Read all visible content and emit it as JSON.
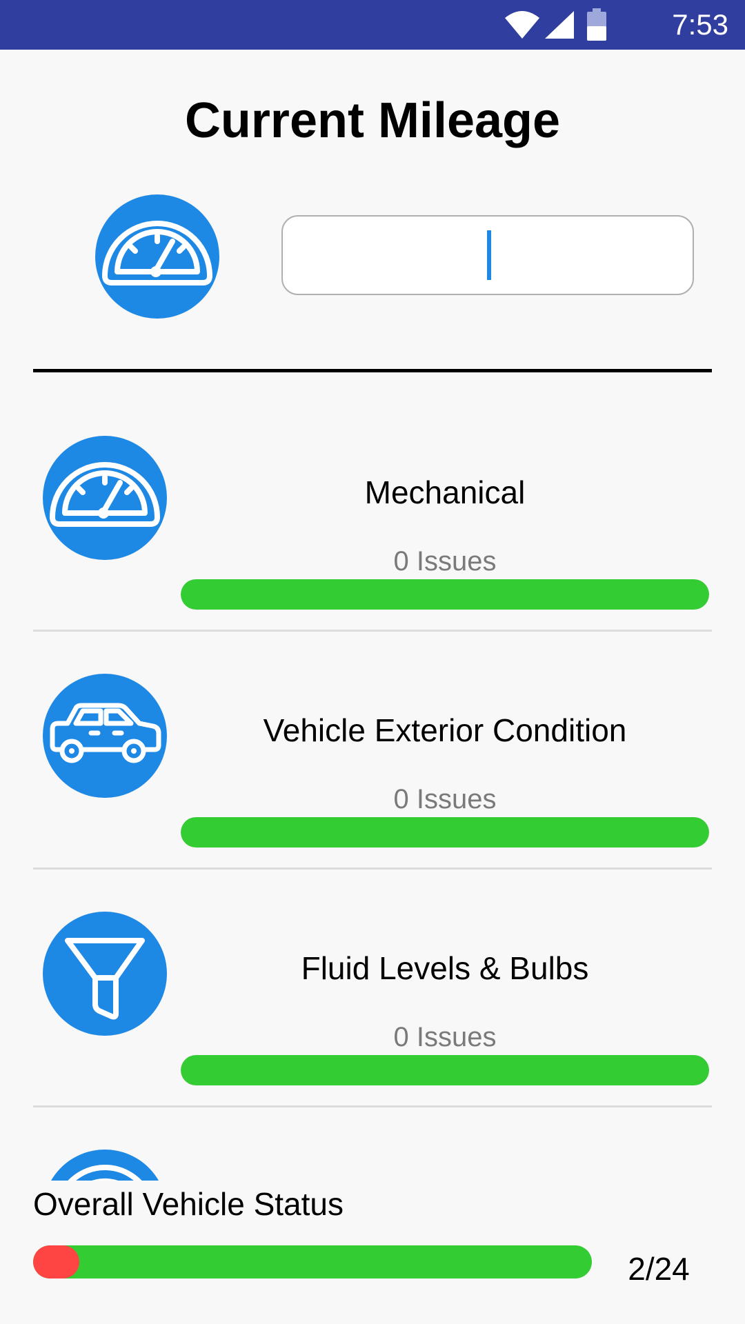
{
  "status_bar": {
    "time": "7:53",
    "icons": [
      "wifi-icon",
      "cell-signal-icon",
      "battery-icon"
    ],
    "color": "#303f9f"
  },
  "header": {
    "title": "Current Mileage"
  },
  "mileage": {
    "icon": "speedometer-icon",
    "value": "",
    "placeholder": ""
  },
  "categories": [
    {
      "name": "Mechanical",
      "issues": "0 Issues",
      "icon": "speedometer-icon",
      "progress": 1.0,
      "bar_color": "#33cc33"
    },
    {
      "name": "Vehicle Exterior Condition",
      "issues": "0 Issues",
      "icon": "car-icon",
      "progress": 1.0,
      "bar_color": "#33cc33"
    },
    {
      "name": "Fluid Levels & Bulbs",
      "issues": "0 Issues",
      "icon": "funnel-icon",
      "progress": 1.0,
      "bar_color": "#33cc33"
    }
  ],
  "overall": {
    "label": "Overall Vehicle Status",
    "count": "2/24",
    "completed": 2,
    "total": 24,
    "fill_color": "#ff4444",
    "track_color": "#33cc33"
  },
  "colors": {
    "accent": "#1e88e5",
    "good": "#33cc33",
    "bad": "#ff4444"
  }
}
